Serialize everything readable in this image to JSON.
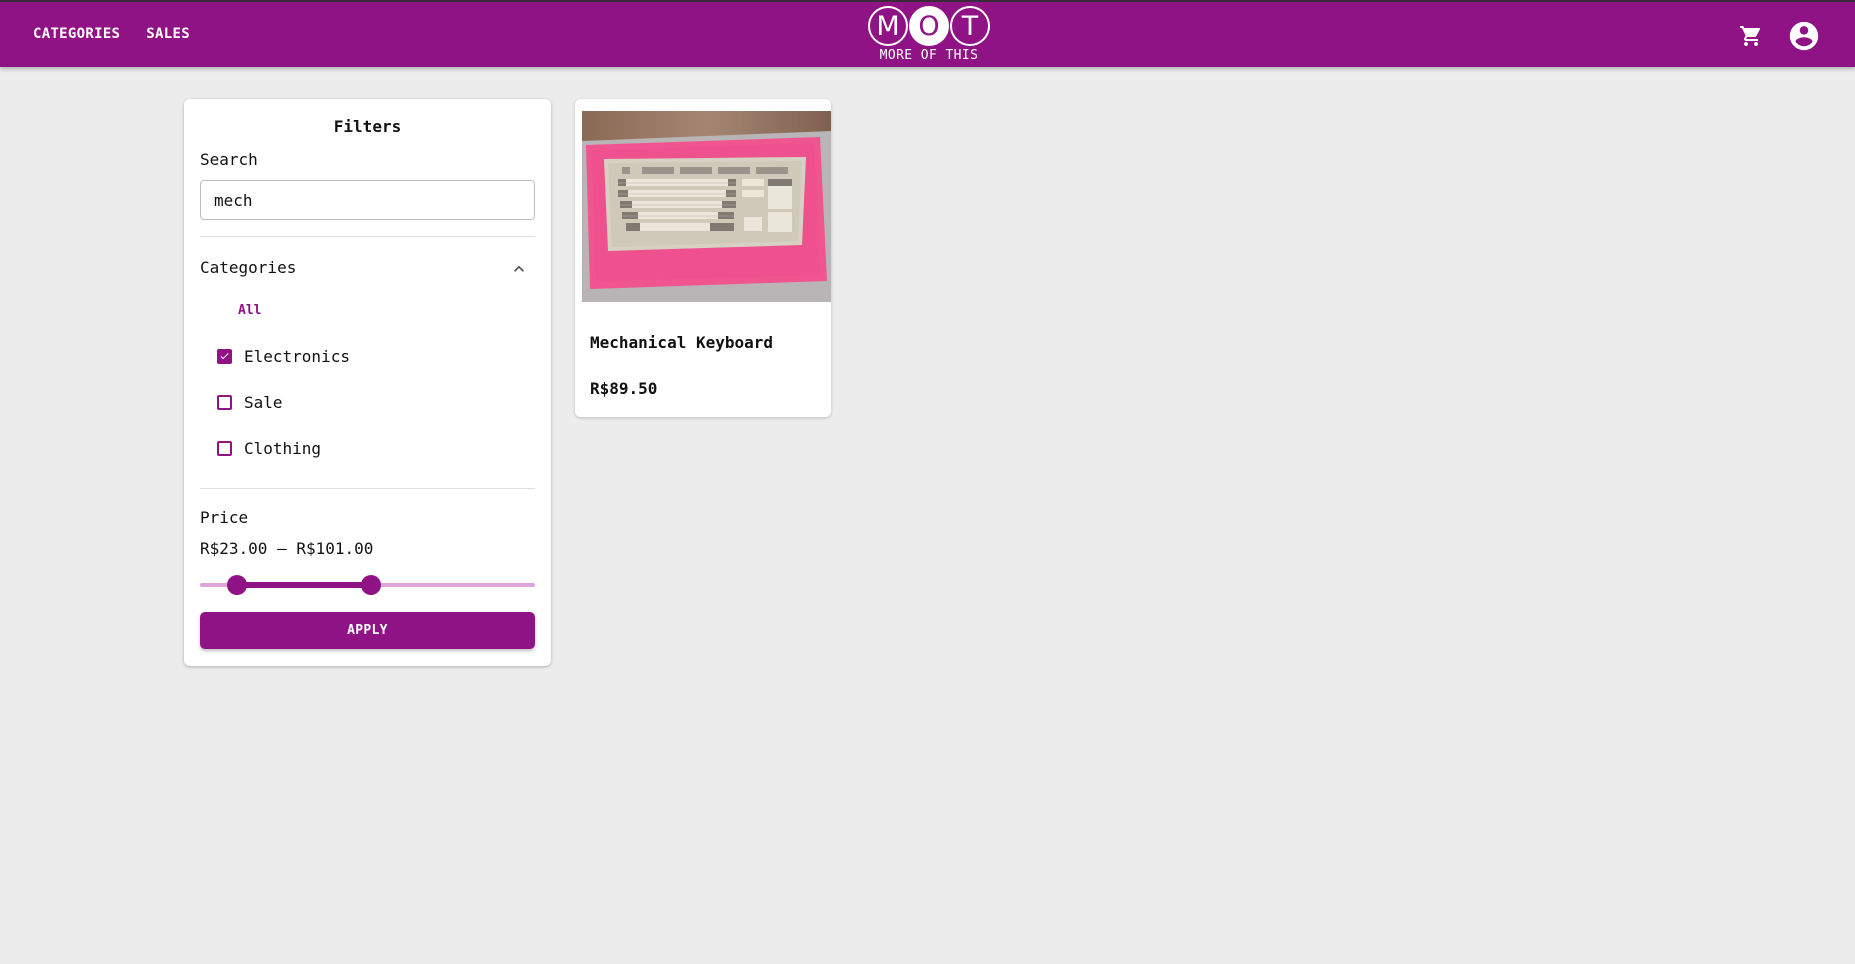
{
  "header": {
    "nav": [
      {
        "label": "CATEGORIES"
      },
      {
        "label": "SALES"
      }
    ],
    "logo": {
      "letters": [
        "M",
        "O",
        "T"
      ],
      "tagline": "MORE OF THIS"
    },
    "icons": {
      "cart": "shopping-cart-icon",
      "account": "account-circle-icon"
    }
  },
  "filters": {
    "title": "Filters",
    "search": {
      "label": "Search",
      "value": "mech"
    },
    "categories": {
      "label": "Categories",
      "expanded": true,
      "all_label": "All",
      "items": [
        {
          "label": "Electronics",
          "checked": true
        },
        {
          "label": "Sale",
          "checked": false
        },
        {
          "label": "Clothing",
          "checked": false
        }
      ]
    },
    "price": {
      "label": "Price",
      "range_text": "R$23.00 – R$101.00",
      "min_fraction": 0.11,
      "max_fraction": 0.51
    },
    "apply_label": "APPLY"
  },
  "products": [
    {
      "name": "Mechanical Keyboard",
      "price": "R$89.50",
      "image": "keyboard-photo"
    }
  ],
  "colors": {
    "brand": "#901386",
    "brand_light": "#dda5d8",
    "background": "#ececec"
  }
}
